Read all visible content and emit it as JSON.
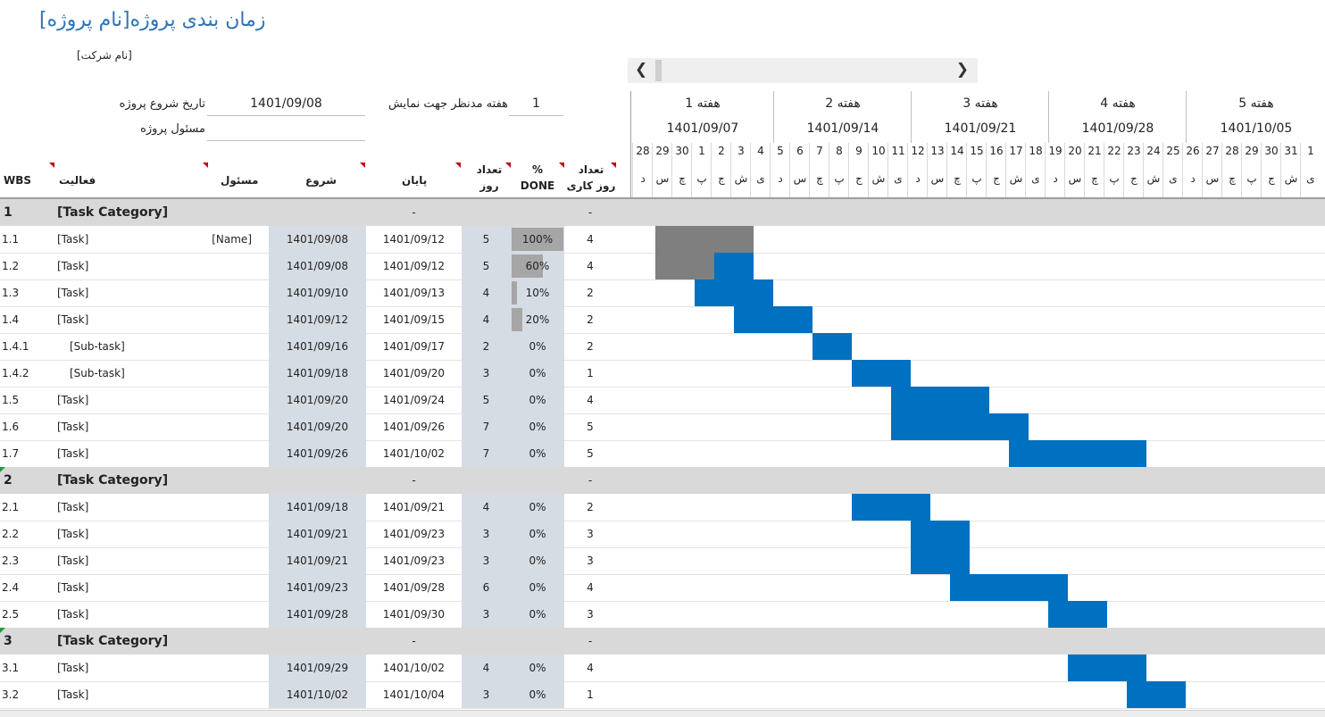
{
  "title": "زمان بندی پروژه[نام پروژه]",
  "company": "[نام شرکت]",
  "project_start_label": "تاریخ شروع پروژه",
  "project_start_value": "1401/09/08",
  "project_owner_label": "مسئول پروژه",
  "display_week_label": "هفته مدنظر جهت نمایش",
  "display_week_value": "1",
  "columns": {
    "wbs": "WBS",
    "activity": "فعالیت",
    "owner": "مسئول",
    "start": "شروع",
    "end": "پایان",
    "days_1": "تعداد",
    "days_2": "روز",
    "done_1": "%",
    "done_2": "DONE",
    "workdays_1": "تعداد",
    "workdays_2": "روز کاری"
  },
  "weeks": [
    {
      "label": "هفته 1",
      "date": "1401/09/07"
    },
    {
      "label": "هفته 2",
      "date": "1401/09/14"
    },
    {
      "label": "هفته 3",
      "date": "1401/09/21"
    },
    {
      "label": "هفته 4",
      "date": "1401/09/28"
    },
    {
      "label": "هفته 5",
      "date": "1401/10/05"
    }
  ],
  "days": [
    {
      "n": "28",
      "w": "د"
    },
    {
      "n": "29",
      "w": "س"
    },
    {
      "n": "30",
      "w": "چ"
    },
    {
      "n": "1",
      "w": "پ"
    },
    {
      "n": "2",
      "w": "ج"
    },
    {
      "n": "3",
      "w": "ش"
    },
    {
      "n": "4",
      "w": "ی"
    },
    {
      "n": "5",
      "w": "د"
    },
    {
      "n": "6",
      "w": "س"
    },
    {
      "n": "7",
      "w": "چ"
    },
    {
      "n": "8",
      "w": "پ"
    },
    {
      "n": "9",
      "w": "ج"
    },
    {
      "n": "10",
      "w": "ش"
    },
    {
      "n": "11",
      "w": "ی"
    },
    {
      "n": "12",
      "w": "د"
    },
    {
      "n": "13",
      "w": "س"
    },
    {
      "n": "14",
      "w": "چ"
    },
    {
      "n": "15",
      "w": "پ"
    },
    {
      "n": "16",
      "w": "ج"
    },
    {
      "n": "17",
      "w": "ش"
    },
    {
      "n": "18",
      "w": "ی"
    },
    {
      "n": "19",
      "w": "د"
    },
    {
      "n": "20",
      "w": "س"
    },
    {
      "n": "21",
      "w": "چ"
    },
    {
      "n": "22",
      "w": "پ"
    },
    {
      "n": "23",
      "w": "ج"
    },
    {
      "n": "24",
      "w": "ش"
    },
    {
      "n": "25",
      "w": "ی"
    },
    {
      "n": "26",
      "w": "د"
    },
    {
      "n": "27",
      "w": "س"
    },
    {
      "n": "28",
      "w": "چ"
    },
    {
      "n": "29",
      "w": "پ"
    },
    {
      "n": "30",
      "w": "ج"
    },
    {
      "n": "31",
      "w": "ش"
    },
    {
      "n": "1",
      "w": "ی"
    }
  ],
  "rows": [
    {
      "type": "cat",
      "wbs": "1",
      "name": "[Task Category]",
      "end": "-",
      "workdays": "-"
    },
    {
      "type": "task",
      "wbs": "1.1",
      "name": "[Task]",
      "owner": "[Name]",
      "start": "1401/09/08",
      "end": "1401/09/12",
      "days": "5",
      "done_text": "100%",
      "done": 1.0,
      "workdays": "4",
      "bar_start": 1,
      "bar_len": 5
    },
    {
      "type": "task",
      "wbs": "1.2",
      "name": "[Task]",
      "owner": "",
      "start": "1401/09/08",
      "end": "1401/09/12",
      "days": "5",
      "done_text": "60%",
      "done": 0.6,
      "workdays": "4",
      "bar_start": 1,
      "bar_len": 5
    },
    {
      "type": "task",
      "wbs": "1.3",
      "name": "[Task]",
      "owner": "",
      "start": "1401/09/10",
      "end": "1401/09/13",
      "days": "4",
      "done_text": "10%",
      "done": 0.1,
      "workdays": "2",
      "bar_start": 3,
      "bar_len": 4
    },
    {
      "type": "task",
      "wbs": "1.4",
      "name": "[Task]",
      "owner": "",
      "start": "1401/09/12",
      "end": "1401/09/15",
      "days": "4",
      "done_text": "20%",
      "done": 0.2,
      "workdays": "2",
      "bar_start": 5,
      "bar_len": 4
    },
    {
      "type": "task",
      "wbs": "1.4.1",
      "name": "[Sub-task]",
      "owner": "",
      "start": "1401/09/16",
      "end": "1401/09/17",
      "days": "2",
      "done_text": "0%",
      "done": 0,
      "workdays": "2",
      "bar_start": 9,
      "bar_len": 2
    },
    {
      "type": "task",
      "wbs": "1.4.2",
      "name": "[Sub-task]",
      "owner": "",
      "start": "1401/09/18",
      "end": "1401/09/20",
      "days": "3",
      "done_text": "0%",
      "done": 0,
      "workdays": "1",
      "bar_start": 11,
      "bar_len": 3
    },
    {
      "type": "task",
      "wbs": "1.5",
      "name": "[Task]",
      "owner": "",
      "start": "1401/09/20",
      "end": "1401/09/24",
      "days": "5",
      "done_text": "0%",
      "done": 0,
      "workdays": "4",
      "bar_start": 13,
      "bar_len": 5
    },
    {
      "type": "task",
      "wbs": "1.6",
      "name": "[Task]",
      "owner": "",
      "start": "1401/09/20",
      "end": "1401/09/26",
      "days": "7",
      "done_text": "0%",
      "done": 0,
      "workdays": "5",
      "bar_start": 13,
      "bar_len": 7
    },
    {
      "type": "task",
      "wbs": "1.7",
      "name": "[Task]",
      "owner": "",
      "start": "1401/09/26",
      "end": "1401/10/02",
      "days": "7",
      "done_text": "0%",
      "done": 0,
      "workdays": "5",
      "bar_start": 19,
      "bar_len": 7
    },
    {
      "type": "cat",
      "wbs": "2",
      "name": "[Task Category]",
      "end": "-",
      "workdays": "-"
    },
    {
      "type": "task",
      "wbs": "2.1",
      "name": "[Task]",
      "owner": "",
      "start": "1401/09/18",
      "end": "1401/09/21",
      "days": "4",
      "done_text": "0%",
      "done": 0,
      "workdays": "2",
      "bar_start": 11,
      "bar_len": 4
    },
    {
      "type": "task",
      "wbs": "2.2",
      "name": "[Task]",
      "owner": "",
      "start": "1401/09/21",
      "end": "1401/09/23",
      "days": "3",
      "done_text": "0%",
      "done": 0,
      "workdays": "3",
      "bar_start": 14,
      "bar_len": 3
    },
    {
      "type": "task",
      "wbs": "2.3",
      "name": "[Task]",
      "owner": "",
      "start": "1401/09/21",
      "end": "1401/09/23",
      "days": "3",
      "done_text": "0%",
      "done": 0,
      "workdays": "3",
      "bar_start": 14,
      "bar_len": 3
    },
    {
      "type": "task",
      "wbs": "2.4",
      "name": "[Task]",
      "owner": "",
      "start": "1401/09/23",
      "end": "1401/09/28",
      "days": "6",
      "done_text": "0%",
      "done": 0,
      "workdays": "4",
      "bar_start": 16,
      "bar_len": 6
    },
    {
      "type": "task",
      "wbs": "2.5",
      "name": "[Task]",
      "owner": "",
      "start": "1401/09/28",
      "end": "1401/09/30",
      "days": "3",
      "done_text": "0%",
      "done": 0,
      "workdays": "3",
      "bar_start": 21,
      "bar_len": 3
    },
    {
      "type": "cat",
      "wbs": "3",
      "name": "[Task Category]",
      "end": "-",
      "workdays": "-"
    },
    {
      "type": "task",
      "wbs": "3.1",
      "name": "[Task]",
      "owner": "",
      "start": "1401/09/29",
      "end": "1401/10/02",
      "days": "4",
      "done_text": "0%",
      "done": 0,
      "workdays": "4",
      "bar_start": 22,
      "bar_len": 4
    },
    {
      "type": "task",
      "wbs": "3.2",
      "name": "[Task]",
      "owner": "",
      "start": "1401/10/02",
      "end": "1401/10/04",
      "days": "3",
      "done_text": "0%",
      "done": 0,
      "workdays": "1",
      "bar_start": 25,
      "bar_len": 3
    }
  ],
  "colors": {
    "bar": "#0070c0",
    "bar_done": "#7f7f7f",
    "category_bg": "#d9d9d9",
    "date_bg": "#d6dce4",
    "title": "#2e74b5"
  }
}
